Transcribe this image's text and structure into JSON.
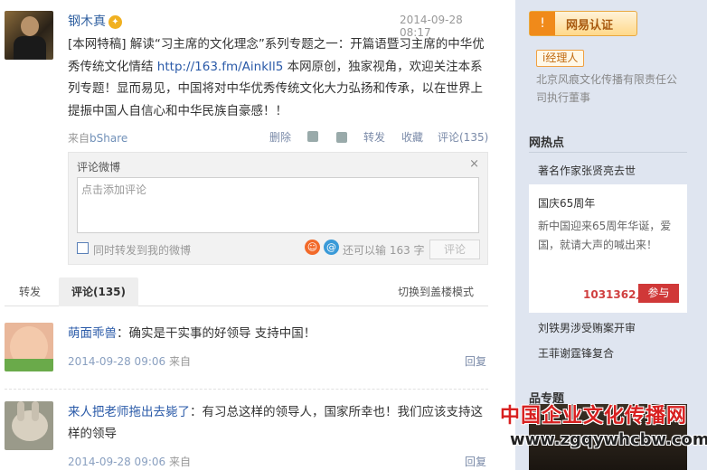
{
  "post": {
    "author": "钢木真",
    "time": "2014-09-28 08:17",
    "text_before": "[本网特稿] 解读“习主席的文化理念”系列专题之一：开篇语暨习主席的中华优秀传统文化情结 ",
    "link": "http://163.fm/AinkIl5",
    "text_after": " 本网原创，独家视角，欢迎关注本系列专题！显而易见，中国将对中华优秀传统文化大力弘扬和传承，以在世界上提振中国人自信心和中华民族自豪感！！",
    "source_prefix": "来自",
    "source": "bShare",
    "actions": {
      "delete": "删除",
      "forward": "转发",
      "favorite": "收藏",
      "comment": "评论(135)"
    }
  },
  "comment_box": {
    "title": "评论微博",
    "close": "×",
    "placeholder": "点击添加评论",
    "forward_label": "同时转发到我的微博",
    "count_text": "还可以输 163 字",
    "submit": "评论"
  },
  "tabs": {
    "forward": "转发",
    "comments": "评论(135)",
    "switch": "切换到盖楼模式"
  },
  "comments": [
    {
      "name": "萌面乖兽",
      "text": "：确实是干实事的好领导 支持中国！",
      "time": "2014-09-28 09:06",
      "from": " 来自",
      "reply": "回复"
    },
    {
      "name": "来人把老师拖出去毙了",
      "text": "：有习总这样的领导人，国家所幸也！我们应该支持这样的领导",
      "time": "2014-09-28 09:06",
      "from": " 来自",
      "reply": "回复"
    }
  ],
  "sidebar": {
    "cert": "网易认证",
    "tag": "i经理人",
    "company": "北京风痕文化传播有限责任公司执行董事",
    "hot_title": "网热点",
    "hot_items": [
      "著名作家张贤亮去世",
      "刘铁男涉受贿案开审",
      "王菲谢霆锋复合"
    ],
    "vote": {
      "title": "国庆65周年",
      "desc": "新中国迎来65周年华诞，爱国，就请大声的喊出来！",
      "count": "1031362人",
      "button": "参与"
    },
    "topic_title": "品专题"
  },
  "watermark": {
    "line1": "中国企业文化传播网",
    "line2": "www.zgqywhcbw.com"
  }
}
